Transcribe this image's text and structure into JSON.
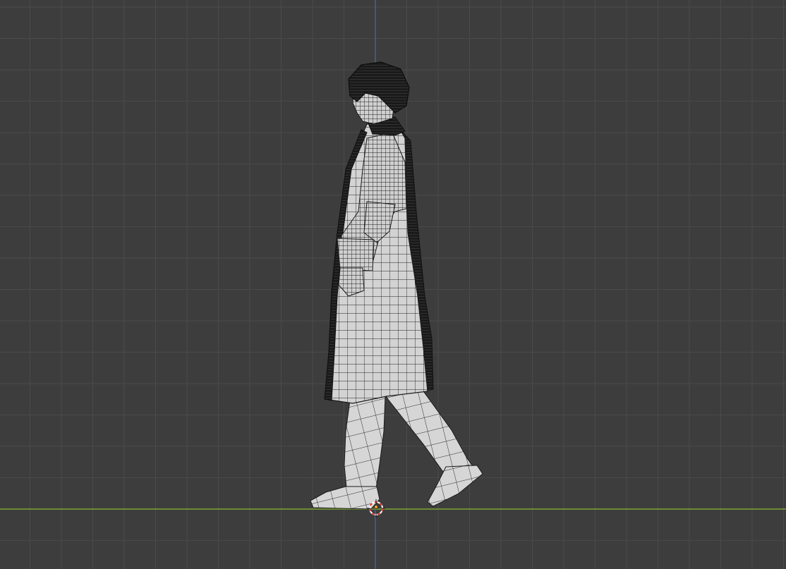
{
  "viewport": {
    "view": "orthographic-side",
    "shading": "wireframe",
    "colors": {
      "background": "#3d3d3d",
      "grid_minor": "#4a4a4a",
      "grid_major": "#555555",
      "axis_y": "#7fa437",
      "axis_z": "#3c6fb8",
      "mesh_fill": "#cfcfcf",
      "mesh_wire": "#1b1b1b",
      "cursor_red": "#e03a2f",
      "origin_dot": "#f0a020"
    }
  },
  "scene": {
    "object": "character-mesh",
    "pose": "walking",
    "parts": [
      "hair",
      "head",
      "coat",
      "arm",
      "left-leg",
      "right-leg",
      "left-shoe",
      "right-shoe"
    ]
  },
  "gizmos": [
    "3d-cursor-icon",
    "origin-point-icon"
  ]
}
